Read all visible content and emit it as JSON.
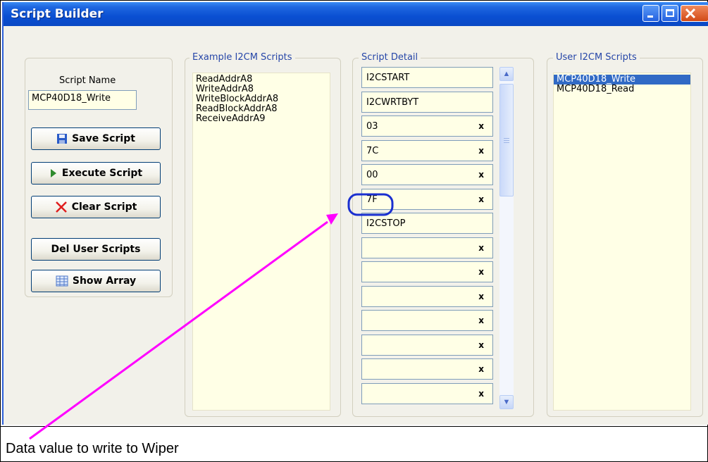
{
  "window": {
    "title": "Script Builder"
  },
  "left_panel": {
    "script_name_label": "Script Name",
    "script_name_value": "MCP40D18_Write",
    "buttons": {
      "save": "Save Script",
      "execute": "Execute Script",
      "clear": "Clear Script",
      "del_user": "Del User Scripts",
      "show_array": "Show Array"
    }
  },
  "example_scripts": {
    "title": "Example I2CM Scripts",
    "items": [
      "ReadAddrA8",
      "WriteAddrA8",
      "WriteBlockAddrA8",
      "ReadBlockAddrA8",
      "ReceiveAddrA9"
    ]
  },
  "script_detail": {
    "title": "Script Detail",
    "rows": [
      {
        "value": "I2CSTART",
        "x": ""
      },
      {
        "value": "I2CWRTBYT",
        "x": ""
      },
      {
        "value": "03",
        "x": "x"
      },
      {
        "value": "7C",
        "x": "x"
      },
      {
        "value": "00",
        "x": "x"
      },
      {
        "value": "7F",
        "x": "x"
      },
      {
        "value": "I2CSTOP",
        "x": ""
      },
      {
        "value": "",
        "x": "x"
      },
      {
        "value": "",
        "x": "x"
      },
      {
        "value": "",
        "x": "x"
      },
      {
        "value": "",
        "x": "x"
      },
      {
        "value": "",
        "x": "x"
      },
      {
        "value": "",
        "x": "x"
      },
      {
        "value": "",
        "x": "x"
      }
    ]
  },
  "user_scripts": {
    "title": "User I2CM Scripts",
    "items": [
      "MCP40D18_Write",
      "MCP40D18_Read"
    ],
    "selected": "MCP40D18_Write"
  },
  "annotation": {
    "text": "Data value to write to Wiper",
    "color": "#ff00ff",
    "highlight_color": "#1a2fd0"
  }
}
